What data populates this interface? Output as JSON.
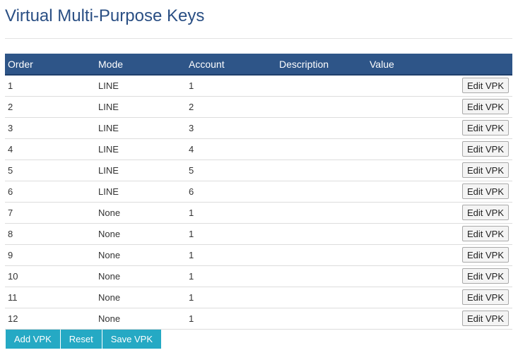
{
  "page": {
    "title": "Virtual Multi-Purpose Keys"
  },
  "table": {
    "headers": [
      "Order",
      "Mode",
      "Account",
      "Description",
      "Value"
    ],
    "edit_label": "Edit VPK",
    "rows": [
      {
        "order": "1",
        "mode": "LINE",
        "account": "1",
        "description": "",
        "value": ""
      },
      {
        "order": "2",
        "mode": "LINE",
        "account": "2",
        "description": "",
        "value": ""
      },
      {
        "order": "3",
        "mode": "LINE",
        "account": "3",
        "description": "",
        "value": ""
      },
      {
        "order": "4",
        "mode": "LINE",
        "account": "4",
        "description": "",
        "value": ""
      },
      {
        "order": "5",
        "mode": "LINE",
        "account": "5",
        "description": "",
        "value": ""
      },
      {
        "order": "6",
        "mode": "LINE",
        "account": "6",
        "description": "",
        "value": ""
      },
      {
        "order": "7",
        "mode": "None",
        "account": "1",
        "description": "",
        "value": ""
      },
      {
        "order": "8",
        "mode": "None",
        "account": "1",
        "description": "",
        "value": ""
      },
      {
        "order": "9",
        "mode": "None",
        "account": "1",
        "description": "",
        "value": ""
      },
      {
        "order": "10",
        "mode": "None",
        "account": "1",
        "description": "",
        "value": ""
      },
      {
        "order": "11",
        "mode": "None",
        "account": "1",
        "description": "",
        "value": ""
      },
      {
        "order": "12",
        "mode": "None",
        "account": "1",
        "description": "",
        "value": ""
      }
    ]
  },
  "actions": {
    "add_label": "Add VPK",
    "reset_label": "Reset",
    "save_label": "Save VPK"
  },
  "colors": {
    "title": "#2a4f84",
    "header_bg": "#2e5588",
    "action_bg": "#25a9c4"
  }
}
